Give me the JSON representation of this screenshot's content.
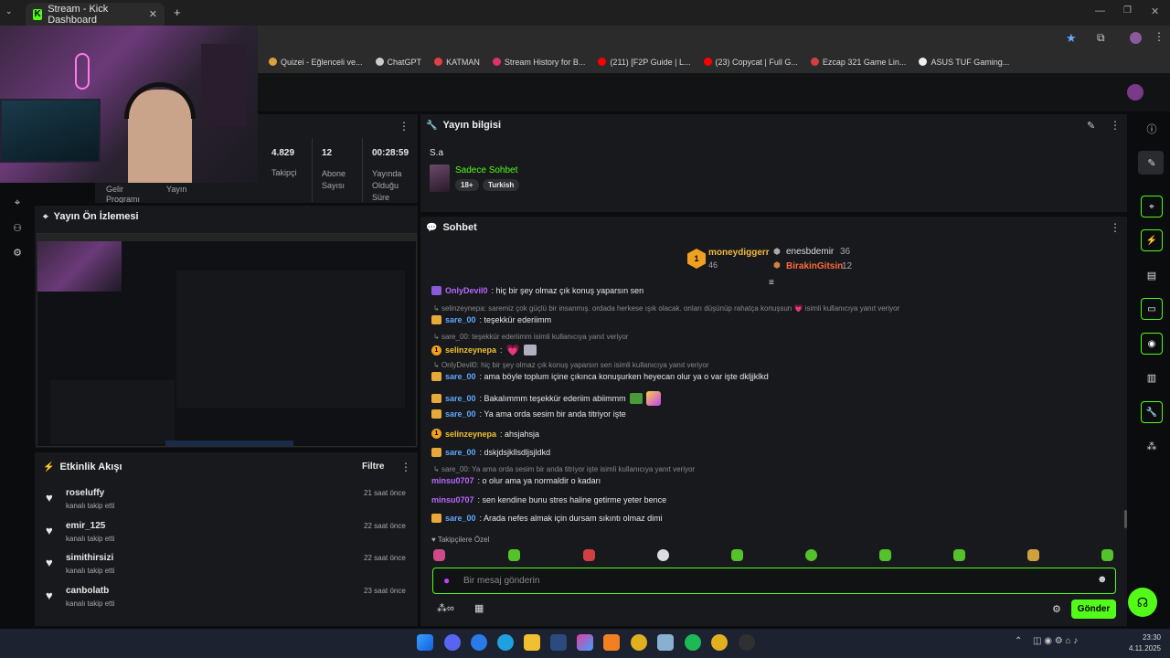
{
  "browser": {
    "tab_title": "Stream - Kick Dashboard",
    "new_tab": "+",
    "bookmarks": [
      "Quizei - Eğlenceli ve...",
      "ChatGPT",
      "KATMAN",
      "Stream History for B...",
      "(211) [F2P Guide | L...",
      "(23) Copycat | Full G...",
      "Ezcap 321 Game Lin...",
      "ASUS TUF Gaming..."
    ]
  },
  "stats": {
    "followers_value": "4.829",
    "followers_label": "Takipçi",
    "subs_value": "12",
    "subs_label": "Abone Sayısı",
    "time_value": "00:28:59",
    "time_label": "Yayında Olduğu Süre",
    "tab_income": "Gelir Programı",
    "tab_stream": "Yayın"
  },
  "stream_info": {
    "title": "Yayın bilgisi",
    "stream_title": "S.a",
    "category": "Sadece Sohbet",
    "tags": [
      "18+",
      "Turkish"
    ]
  },
  "preview": {
    "title": "Yayın Ön İzlemesi"
  },
  "activity": {
    "title": "Etkinlik Akışı",
    "filter": "Filtre",
    "items": [
      {
        "name": "roseluffy",
        "action": "kanalı takip etti",
        "time": "21 saat önce"
      },
      {
        "name": "emir_125",
        "action": "kanalı takip etti",
        "time": "22 saat önce"
      },
      {
        "name": "simithirsizi",
        "action": "kanalı takip etti",
        "time": "22 saat önce"
      },
      {
        "name": "canbolatb",
        "action": "kanalı takip etti",
        "time": "23 saat önce"
      }
    ]
  },
  "chat": {
    "title": "Sohbet",
    "leaderboard": {
      "first_name": "moneydiggerr",
      "first_count": "46",
      "second_name": "enesbdemir",
      "second_count": "36",
      "third_name": "BirakinGitsin",
      "third_count": "12"
    },
    "messages": [
      {
        "reply": "",
        "user": "OnlyDevil0",
        "text": ": hiç bir şey olmaz çık konuş yaparsın sen"
      },
      {
        "reply": "selinzeynepa: saremiz çok güçlü bir insanmış. ordada herkese ışık olacak. onları düşünüp rahatça konuşsun",
        "reply_suffix": "isimli kullanıcıya yanıt veriyor",
        "user": "sare_00",
        "text": ": teşekkür ederiimm"
      },
      {
        "reply": "sare_00: teşekkür ederiimm isimli kullanıcıya yanıt veriyor",
        "user": "selinzeynepa",
        "text": ":"
      },
      {
        "reply": "OnlyDevil0: hiç bir şey olmaz çık konuş yaparsın sen isimli kullanıcıya yanıt veriyor",
        "user": "sare_00",
        "text": ": ama böyle toplum içine çıkınca konuşurken heyecan olur ya o var işte dkljjklkd"
      },
      {
        "reply": "",
        "user": "sare_00",
        "text": ": Bakalımmm teşekkür ederiim abiimmm"
      },
      {
        "reply": "",
        "user": "sare_00",
        "text": ": Ya ama orda sesim bir anda titriyor işte"
      },
      {
        "reply": "",
        "user": "selinzeynepa",
        "text": ": ahsjahsja"
      },
      {
        "reply": "",
        "user": "sare_00",
        "text": ": dskjdsjkllsdljsjldkd"
      },
      {
        "reply": "sare_00: Ya ama orda sesim bir anda titriyor işte isimli kullanıcıya yanıt veriyor",
        "user": "minsu0707",
        "text": ": o olur ama ya normaldir o kadarı"
      },
      {
        "reply": "",
        "user": "minsu0707",
        "text": ": sen kendine bunu stres haline getirme yeter bence"
      },
      {
        "reply": "",
        "user": "sare_00",
        "text": ": Arada nefes almak için dursam sıkıntı olmaz dimi"
      }
    ],
    "followers_only": "Takipçilere Özel",
    "placeholder": "Bir mesaj gönderin",
    "send": "Gönder"
  },
  "taskbar": {
    "time": "23:30",
    "date": "4.11.2025"
  },
  "colors": {
    "accent": "#53fc18",
    "panel": "#18191c",
    "background": "#0b0c0e"
  }
}
